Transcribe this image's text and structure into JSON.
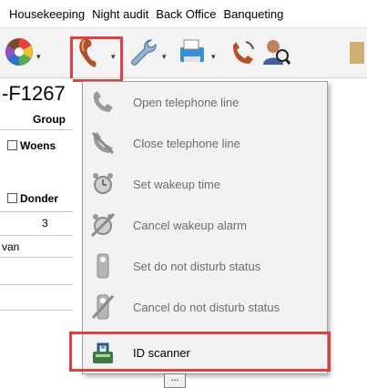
{
  "menubar": {
    "items": [
      "Housekeeping",
      "Night audit",
      "Back Office",
      "Banqueting"
    ]
  },
  "toolbar": {
    "buttons": [
      {
        "icon": "color-wheel-icon"
      },
      {
        "icon": "telephone-handset-icon"
      },
      {
        "icon": "wrench-icon"
      },
      {
        "icon": "printer-icon"
      },
      {
        "icon": "phone-ring-icon"
      },
      {
        "icon": "person-search-icon"
      }
    ],
    "dropdown_glyph": "▾"
  },
  "background": {
    "reservation_id": "-F1267",
    "column_header": "Group",
    "row1": "Woens",
    "row2": "Donder",
    "cell_value": "3",
    "name_value": "van",
    "ellipsis": "..."
  },
  "menu": {
    "items": [
      {
        "label": "Open telephone line",
        "icon": "phone-open-icon",
        "enabled": false
      },
      {
        "label": "Close telephone line",
        "icon": "phone-closed-icon",
        "enabled": false
      },
      {
        "label": "Set wakeup time",
        "icon": "alarm-clock-icon",
        "enabled": false
      },
      {
        "label": "Cancel wakeup alarm",
        "icon": "alarm-cancel-icon",
        "enabled": false
      },
      {
        "label": "Set do not disturb status",
        "icon": "do-not-disturb-icon",
        "enabled": false
      },
      {
        "label": "Cancel do not disturb status",
        "icon": "cancel-dnd-icon",
        "enabled": false
      },
      {
        "label": "ID scanner",
        "icon": "id-scanner-icon",
        "enabled": true
      }
    ]
  },
  "colors": {
    "highlight": "#e04040",
    "menu_bg": "#f2f2f2",
    "disabled_text": "#6d6d6d"
  }
}
